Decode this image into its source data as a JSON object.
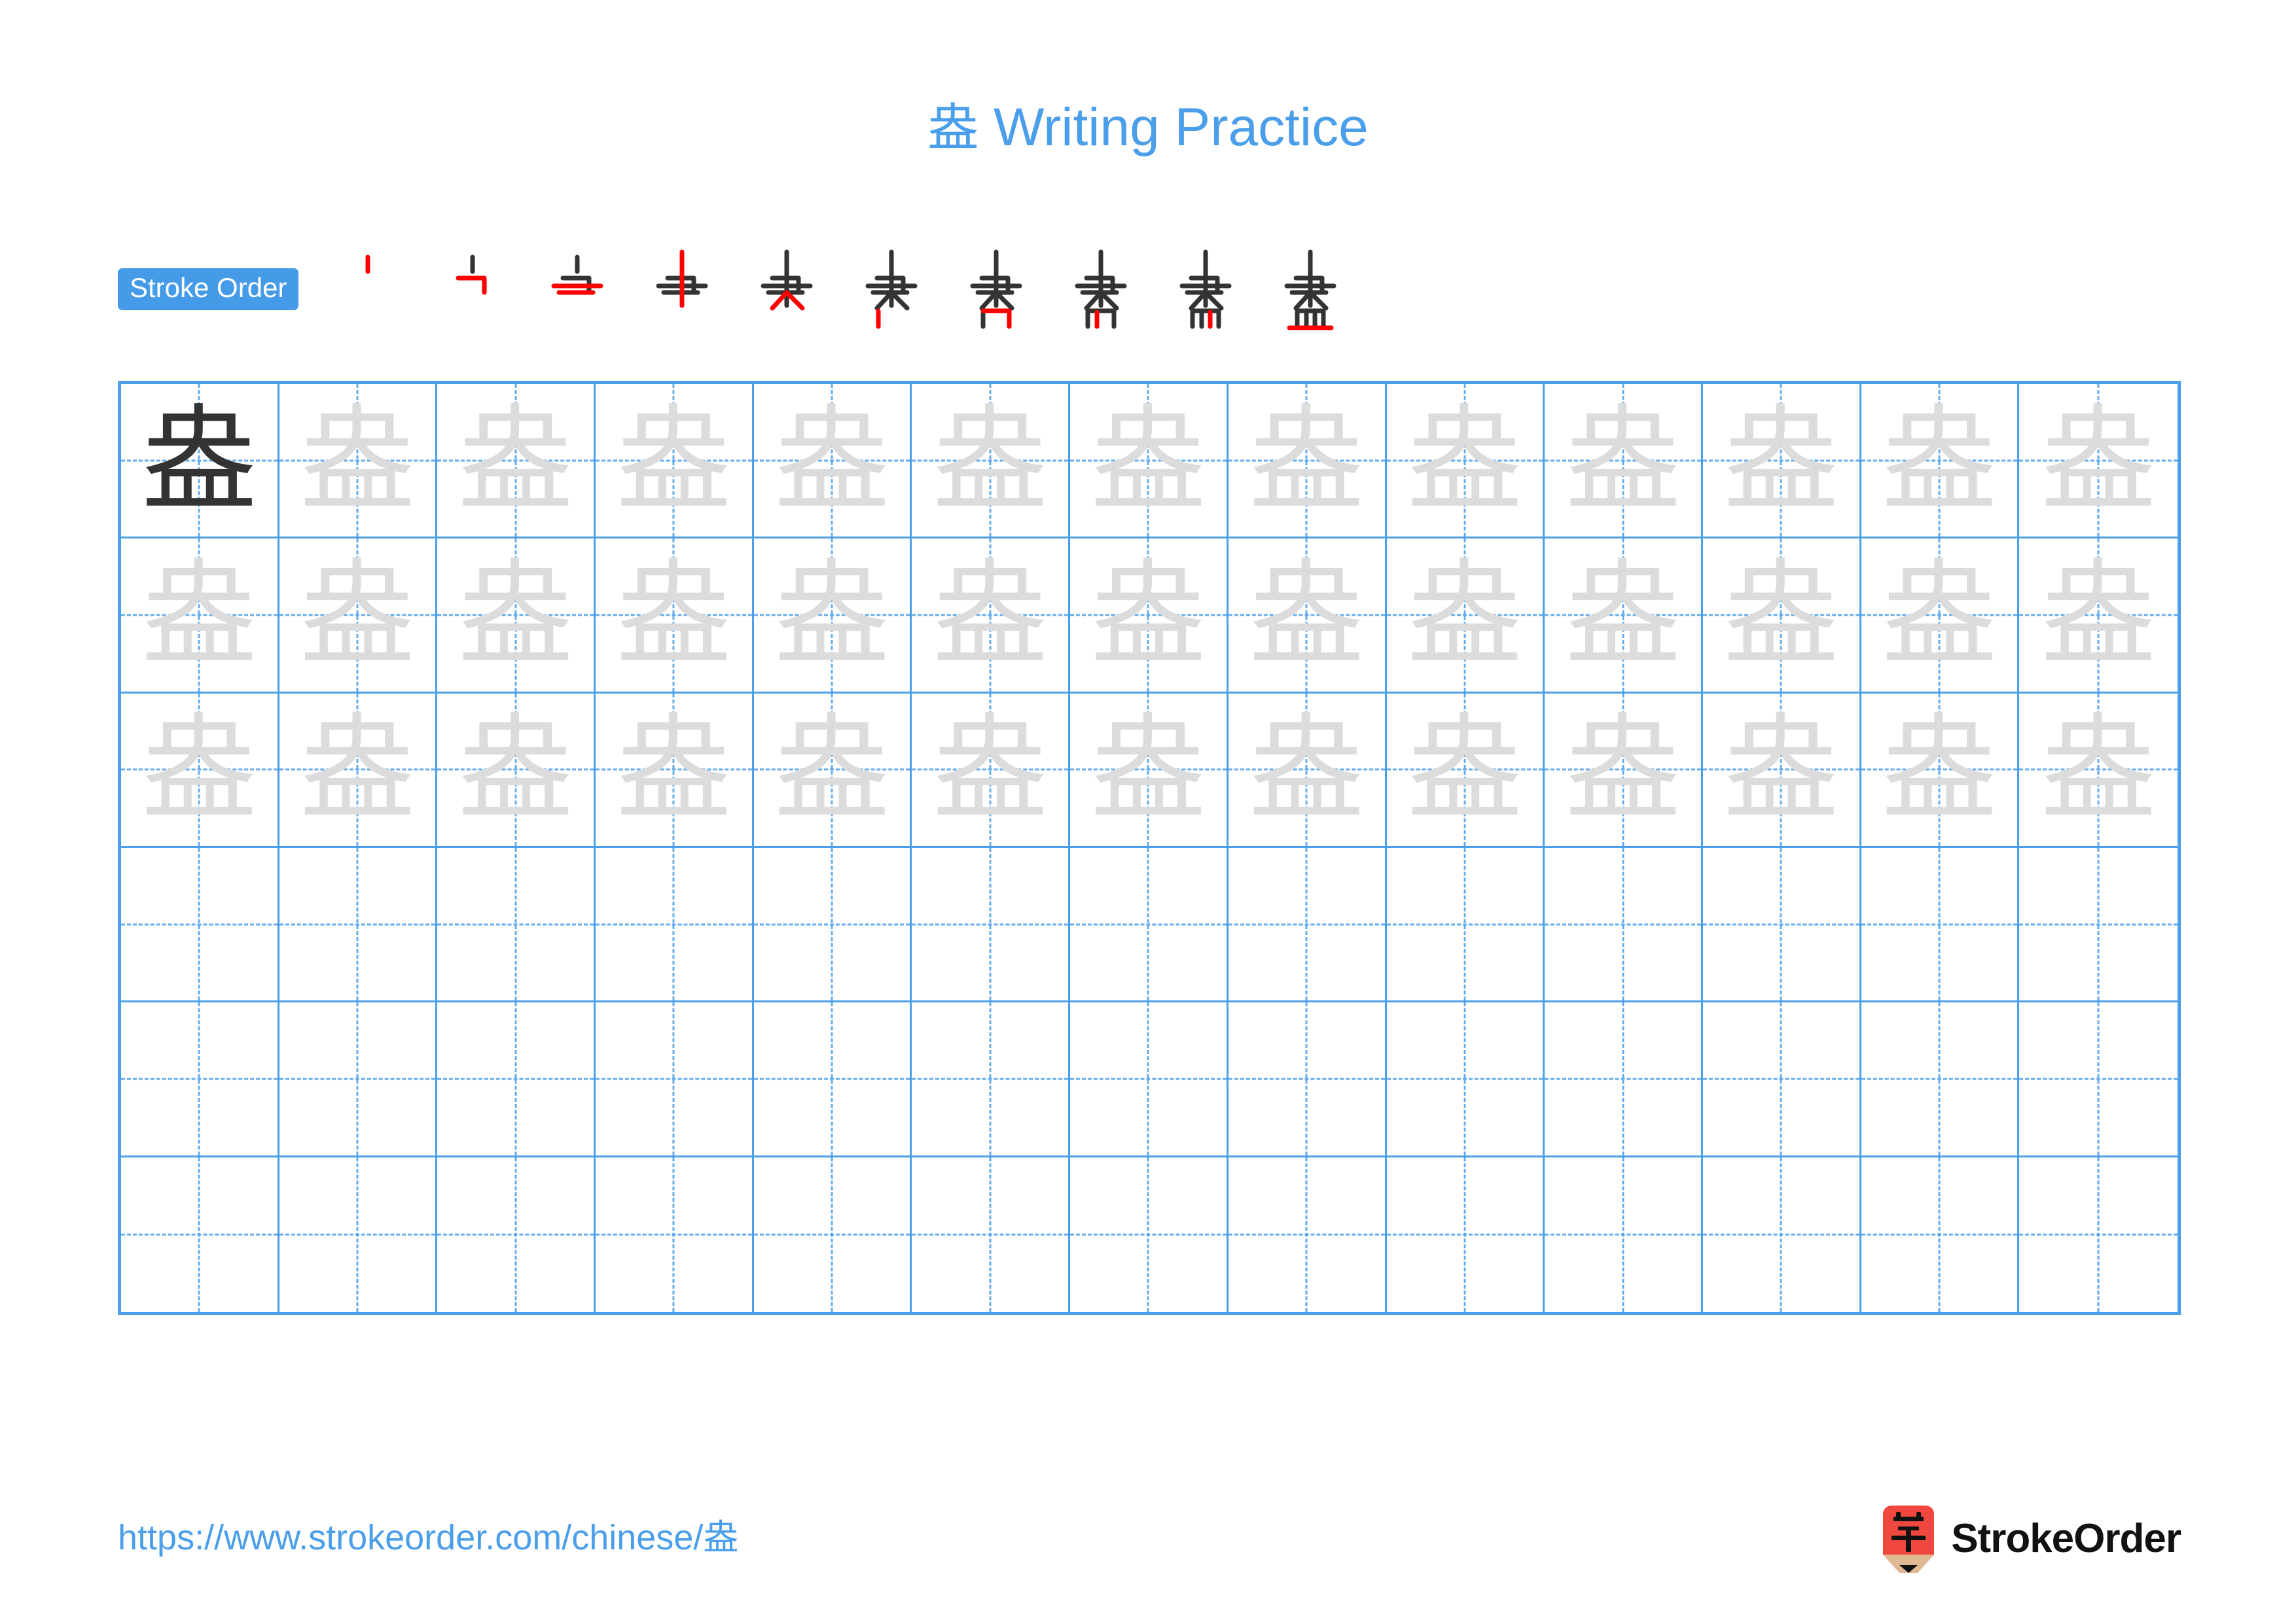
{
  "character": "盎",
  "header": {
    "title_char": "盎",
    "title_text": " Writing Practice",
    "title_full": "盎 Writing Practice",
    "title_color": "#4A9EEA"
  },
  "stroke_order": {
    "badge_label": "Stroke Order",
    "badge_bg": "#459BE8",
    "badge_text_color": "#FFFFFF",
    "new_stroke_color": "#FF0000",
    "prev_stroke_color": "#333333",
    "stroke_count": 10,
    "steps": [
      {
        "index": 1,
        "label": "丶",
        "new_stroke": "dot"
      },
      {
        "index": 2,
        "label": "冂",
        "new_stroke": "horizontal-turn-vertical"
      },
      {
        "index": 3,
        "label": "口",
        "new_stroke": "horizontal"
      },
      {
        "index": 4,
        "label": "央",
        "new_stroke": "vertical"
      },
      {
        "index": 5,
        "label": "央",
        "new_stroke": "right-falling"
      },
      {
        "index": 6,
        "label": "盎",
        "new_stroke": "vertical"
      },
      {
        "index": 7,
        "label": "盎",
        "new_stroke": "horizontal-turn-vertical"
      },
      {
        "index": 8,
        "label": "盎",
        "new_stroke": "vertical"
      },
      {
        "index": 9,
        "label": "盎",
        "new_stroke": "vertical"
      },
      {
        "index": 10,
        "label": "盎",
        "new_stroke": "horizontal"
      }
    ]
  },
  "practice_grid": {
    "columns": 13,
    "rows": 6,
    "grid_line_color": "#4A9EEA",
    "model_char_color": "#333333",
    "trace_char_color": "#DCDCDC",
    "cells": [
      [
        "盎",
        "盎",
        "盎",
        "盎",
        "盎",
        "盎",
        "盎",
        "盎",
        "盎",
        "盎",
        "盎",
        "盎",
        "盎"
      ],
      [
        "盎",
        "盎",
        "盎",
        "盎",
        "盎",
        "盎",
        "盎",
        "盎",
        "盎",
        "盎",
        "盎",
        "盎",
        "盎"
      ],
      [
        "盎",
        "盎",
        "盎",
        "盎",
        "盎",
        "盎",
        "盎",
        "盎",
        "盎",
        "盎",
        "盎",
        "盎",
        "盎"
      ],
      [
        "",
        "",
        "",
        "",
        "",
        "",
        "",
        "",
        "",
        "",
        "",
        "",
        ""
      ],
      [
        "",
        "",
        "",
        "",
        "",
        "",
        "",
        "",
        "",
        "",
        "",
        "",
        ""
      ],
      [
        "",
        "",
        "",
        "",
        "",
        "",
        "",
        "",
        "",
        "",
        "",
        "",
        ""
      ]
    ],
    "cell_styles": [
      [
        "dark",
        "light",
        "light",
        "light",
        "light",
        "light",
        "light",
        "light",
        "light",
        "light",
        "light",
        "light",
        "light"
      ],
      [
        "light",
        "light",
        "light",
        "light",
        "light",
        "light",
        "light",
        "light",
        "light",
        "light",
        "light",
        "light",
        "light"
      ],
      [
        "light",
        "light",
        "light",
        "light",
        "light",
        "light",
        "light",
        "light",
        "light",
        "light",
        "light",
        "light",
        "light"
      ],
      [
        "empty",
        "empty",
        "empty",
        "empty",
        "empty",
        "empty",
        "empty",
        "empty",
        "empty",
        "empty",
        "empty",
        "empty",
        "empty"
      ],
      [
        "empty",
        "empty",
        "empty",
        "empty",
        "empty",
        "empty",
        "empty",
        "empty",
        "empty",
        "empty",
        "empty",
        "empty",
        "empty"
      ],
      [
        "empty",
        "empty",
        "empty",
        "empty",
        "empty",
        "empty",
        "empty",
        "empty",
        "empty",
        "empty",
        "empty",
        "empty",
        "empty"
      ]
    ]
  },
  "footer": {
    "url": "https://www.strokeorder.com/chinese/盎",
    "url_color": "#4A9EEA",
    "logo_char": "字",
    "logo_badge_color": "#F0483E",
    "logo_tip_color": "#E0B894",
    "logo_point_color": "#111111",
    "brand_name": "StrokeOrder"
  }
}
